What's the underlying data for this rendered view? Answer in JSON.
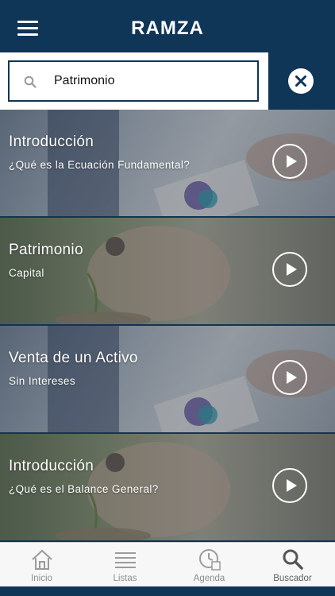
{
  "header": {
    "title": "RAMZA",
    "menu_icon": "hamburger-menu-icon"
  },
  "search": {
    "value": "Patrimonio",
    "icon": "search-icon",
    "clear_icon": "close-icon"
  },
  "items": [
    {
      "title": "Introducción",
      "subtitle": "¿Qué es la Ecuación Fundamental?",
      "image": "business-chart-photo",
      "action_icon": "play-icon"
    },
    {
      "title": "Patrimonio",
      "subtitle": "Capital",
      "image": "coins-plant-photo",
      "action_icon": "play-icon"
    },
    {
      "title": "Venta de un Activo",
      "subtitle": "Sin Intereses",
      "image": "business-chart-photo",
      "action_icon": "play-icon"
    },
    {
      "title": "Introducción",
      "subtitle": "¿Qué es el Balance General?",
      "image": "coins-plant-photo",
      "action_icon": "play-icon"
    }
  ],
  "tabs": [
    {
      "label": "Inicio",
      "icon": "home-icon"
    },
    {
      "label": "Listas",
      "icon": "list-icon"
    },
    {
      "label": "Agenda",
      "icon": "clock-calendar-icon"
    },
    {
      "label": "Buscador",
      "icon": "search-icon",
      "active": true
    }
  ],
  "colors": {
    "primary": "#0f3557",
    "tab_inactive": "#8d8d8d",
    "tab_active": "#606060"
  }
}
